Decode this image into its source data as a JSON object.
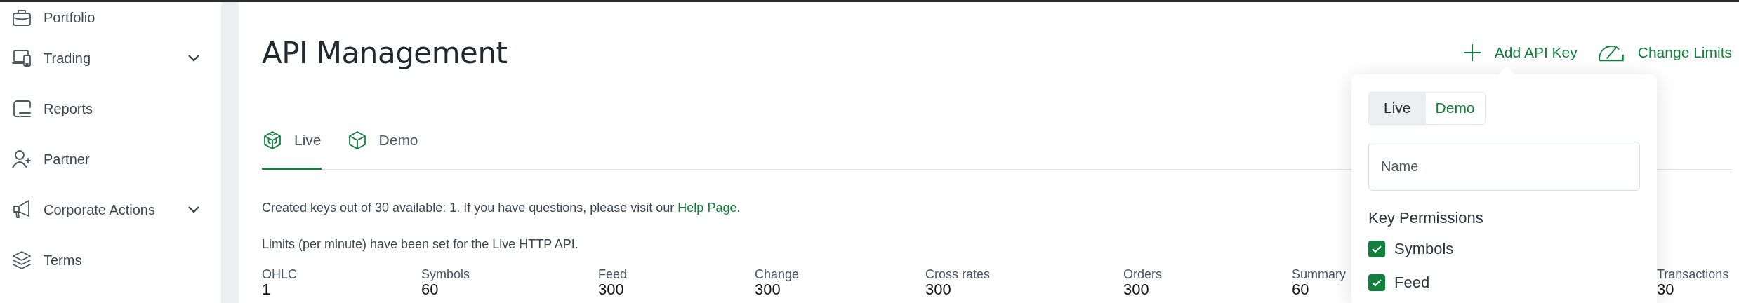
{
  "sidebar": {
    "items": [
      {
        "label": "Portfolio",
        "expandable": false
      },
      {
        "label": "Trading",
        "expandable": true
      },
      {
        "label": "Reports",
        "expandable": false
      },
      {
        "label": "Partner",
        "expandable": false
      },
      {
        "label": "Corporate Actions",
        "expandable": true
      },
      {
        "label": "Terms",
        "expandable": false
      }
    ]
  },
  "header": {
    "title": "API Management",
    "actions": [
      {
        "label": "Add API Key"
      },
      {
        "label": "Change Limits"
      }
    ]
  },
  "tabs": [
    {
      "label": "Live",
      "selected": true
    },
    {
      "label": "Demo",
      "selected": false
    }
  ],
  "notice": {
    "text": "Created keys out of 30 available: 1. If you have questions, please visit our",
    "link": "Help Page",
    "after": "."
  },
  "limits": {
    "caption": "Limits (per minute) have been set for the Live HTTP API.",
    "items": [
      {
        "name": "OHLC",
        "value": "1"
      },
      {
        "name": "Symbols",
        "value": "60"
      },
      {
        "name": "Feed",
        "value": "300"
      },
      {
        "name": "Change",
        "value": "300"
      },
      {
        "name": "Cross rates",
        "value": "300"
      },
      {
        "name": "Orders",
        "value": "300"
      },
      {
        "name": "Summary",
        "value": "60"
      },
      {
        "name": "Transactions",
        "value": "30"
      }
    ]
  },
  "popup": {
    "segments": [
      {
        "label": "Live",
        "selected": true
      },
      {
        "label": "Demo",
        "selected": false
      }
    ],
    "name_field": {
      "placeholder": "Name"
    },
    "permissions_title": "Key Permissions",
    "permissions": [
      {
        "label": "Symbols",
        "checked": true
      },
      {
        "label": "Feed",
        "checked": true
      }
    ]
  }
}
